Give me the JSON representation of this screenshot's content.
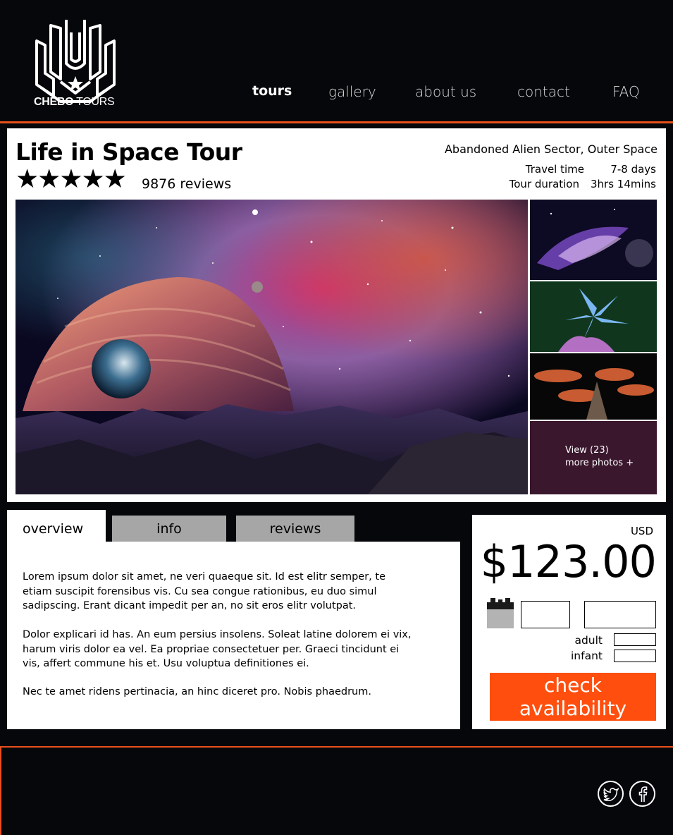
{
  "brand": {
    "name_bold": "CHEBO",
    "name_light": "TOURS"
  },
  "nav": {
    "items": [
      {
        "label": "tours",
        "active": true
      },
      {
        "label": "gallery"
      },
      {
        "label": "about us"
      },
      {
        "label": "contact"
      },
      {
        "label": "FAQ"
      }
    ]
  },
  "tour": {
    "title": "Life in Space Tour",
    "rating_stars": 5,
    "stars_text": "★★★★★",
    "reviews": "9876 reviews",
    "location": "Abandoned Alien Sector, Outer Space",
    "travel_time_label": "Travel time",
    "travel_time_value": "7-8 days",
    "duration_label": "Tour duration",
    "duration_value": "3hrs 14mins",
    "more_photos_line1": "View (23)",
    "more_photos_line2": "more photos +"
  },
  "tabs": [
    {
      "label": "overview",
      "active": true
    },
    {
      "label": "info"
    },
    {
      "label": "reviews"
    }
  ],
  "overview": {
    "paragraphs": [
      "Lorem ipsum dolor sit amet, ne veri quaeque sit. Id est elitr semper, te etiam suscipit forensibus vis. Cu sea congue rationibus, eu duo simul sadipscing. Erant dicant impedit per an, no sit eros elitr volutpat.",
      "Dolor explicari id has. An eum persius insolens. Soleat latine dolorem ei vix, harum viris dolor ea vel. Ea propriae consectetuer per. Graeci tincidunt ei vis, affert commune his et. Usu voluptua definitiones ei.",
      "Nec te amet ridens pertinacia, an hinc diceret pro. Nobis phaedrum."
    ]
  },
  "booking": {
    "currency": "USD",
    "price": "$123.00",
    "adult_label": "adult",
    "infant_label": "infant",
    "cta_label": "check availability"
  },
  "colors": {
    "accent": "#e8501c",
    "cta": "#ff4e0e",
    "background": "#05070a",
    "tab_inactive": "#a6a6a6"
  },
  "icons": [
    "logo-emblem",
    "calendar-icon",
    "twitter-icon",
    "facebook-icon",
    "star-icon"
  ]
}
